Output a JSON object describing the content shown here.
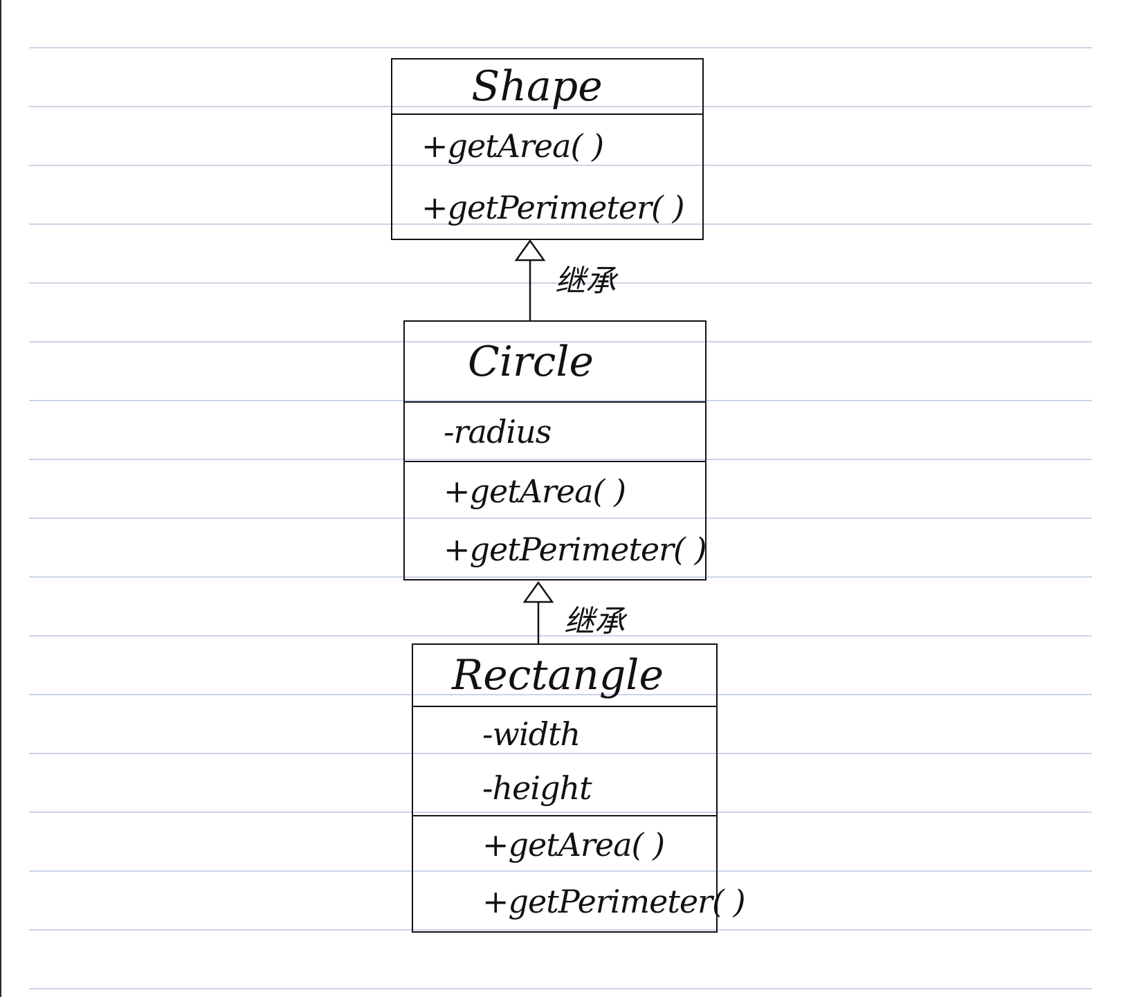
{
  "diagram": {
    "classes": [
      {
        "name": "Shape",
        "attributes": [],
        "methods": [
          "+getArea( )",
          "+getPerimeter( )"
        ]
      },
      {
        "name": "Circle",
        "attributes": [
          "-radius"
        ],
        "methods": [
          "+getArea( )",
          "+getPerimeter( )"
        ]
      },
      {
        "name": "Rectangle",
        "attributes": [
          "-width",
          "-height"
        ],
        "methods": [
          "+getArea( )",
          "+getPerimeter( )"
        ]
      }
    ],
    "relations": [
      {
        "from": "Circle",
        "to": "Shape",
        "type": "inheritance",
        "label": "继承"
      },
      {
        "from": "Rectangle",
        "to": "Circle",
        "type": "inheritance",
        "label": "继承"
      }
    ]
  },
  "colors": {
    "ink": "#111111",
    "rule_line": "#b9c7dd",
    "paper": "#ffffff"
  }
}
